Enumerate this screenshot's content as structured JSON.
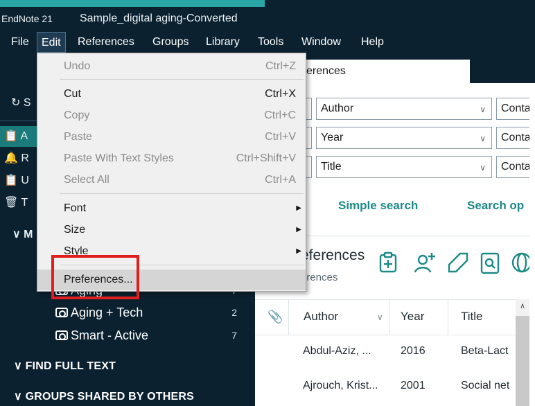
{
  "window": {
    "app_name": "EndNote 21",
    "doc_name": "Sample_digital aging-Converted"
  },
  "menu_bar": [
    "File",
    "Edit",
    "References",
    "Groups",
    "Library",
    "Tools",
    "Window",
    "Help"
  ],
  "edit_menu": {
    "items": [
      {
        "label": "Undo",
        "shortcut": "Ctrl+Z",
        "enabled": false
      },
      {
        "label": "Cut",
        "shortcut": "Ctrl+X",
        "enabled": true
      },
      {
        "label": "Copy",
        "shortcut": "Ctrl+C",
        "enabled": false
      },
      {
        "label": "Paste",
        "shortcut": "Ctrl+V",
        "enabled": false
      },
      {
        "label": "Paste With Text Styles",
        "shortcut": "Ctrl+Shift+V",
        "enabled": false
      },
      {
        "label": "Select All",
        "shortcut": "Ctrl+A",
        "enabled": false
      },
      {
        "label": "Font",
        "submenu": true,
        "enabled": true
      },
      {
        "label": "Size",
        "submenu": true,
        "enabled": true
      },
      {
        "label": "Style",
        "submenu": true,
        "enabled": true
      },
      {
        "label": "Preferences...",
        "enabled": true,
        "highlighted": true
      }
    ]
  },
  "sidebar": {
    "sync_label": "S",
    "items_partial": [
      "A",
      "R",
      "U",
      "T"
    ],
    "my_groups_partial": "M",
    "groups": [
      {
        "name": "Aging",
        "count": "7"
      },
      {
        "name": "Aging + Tech",
        "count": "2"
      },
      {
        "name": "Smart - Active",
        "count": "7"
      }
    ],
    "find_full_text": "FIND FULL TEXT",
    "groups_shared": "GROUPS SHARED BY OTHERS"
  },
  "tab": {
    "label": "erences"
  },
  "search": {
    "rows": [
      {
        "field": "Author",
        "op": "Conta"
      },
      {
        "field": "Year",
        "op": "Conta"
      },
      {
        "field": "Title",
        "op": "Conta"
      }
    ],
    "simple_search": "Simple search",
    "search_options": "Search op"
  },
  "references_panel": {
    "title": "eferences",
    "subtitle": "erences"
  },
  "table": {
    "columns": [
      "Author",
      "Year",
      "Title"
    ],
    "rows": [
      {
        "author": "Abdul-Aziz, ...",
        "year": "2016",
        "title": "Beta-Lact"
      },
      {
        "author": "Ajrouch, Krist...",
        "year": "2001",
        "title": "Social net"
      }
    ]
  },
  "colors": {
    "accent": "#1b8a86",
    "highlight_border": "#e01e1e",
    "sidebar_bg": "#0b2130"
  }
}
